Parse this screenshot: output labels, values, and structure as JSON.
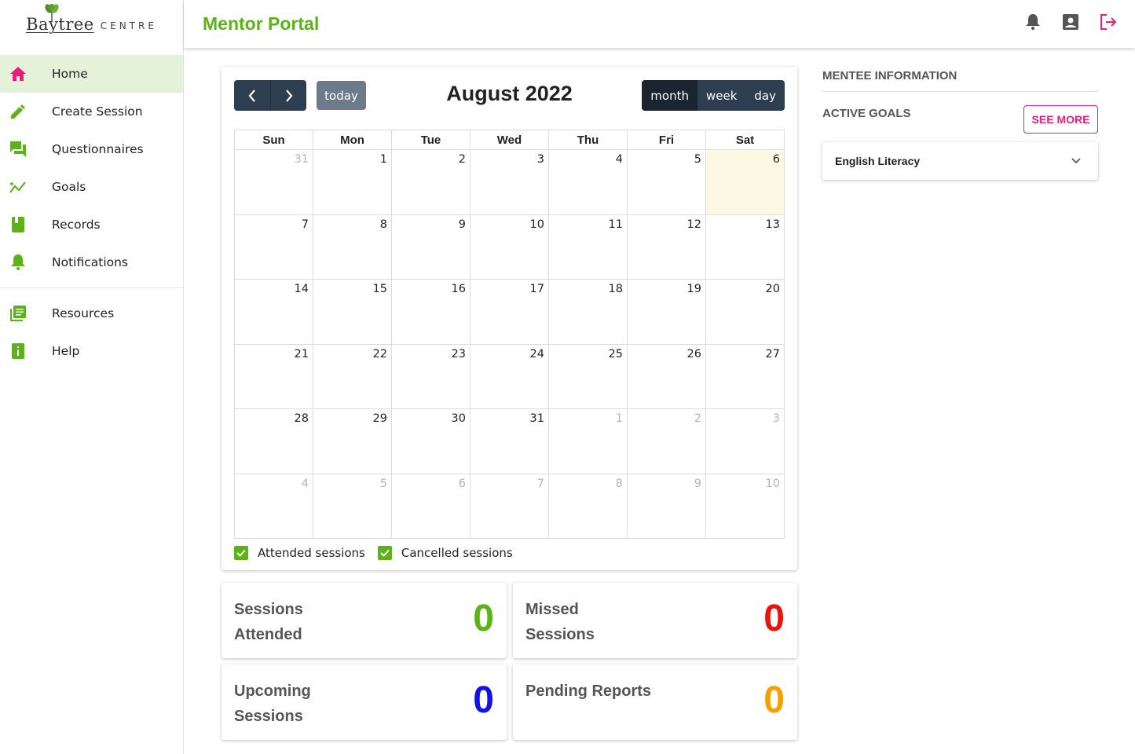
{
  "logo": {
    "main": "Baytree",
    "sub": "CENTRE"
  },
  "header": {
    "title": "Mentor Portal"
  },
  "sidebar": {
    "items": [
      {
        "label": "Home",
        "icon": "home-icon",
        "active": true
      },
      {
        "label": "Create Session",
        "icon": "pencil-icon"
      },
      {
        "label": "Questionnaires",
        "icon": "forum-icon"
      },
      {
        "label": "Goals",
        "icon": "sparkline-icon"
      },
      {
        "label": "Records",
        "icon": "book-icon"
      },
      {
        "label": "Notifications",
        "icon": "bell-icon"
      }
    ],
    "secondary": [
      {
        "label": "Resources",
        "icon": "list-document-icon"
      },
      {
        "label": "Help",
        "icon": "info-icon"
      }
    ]
  },
  "calendar": {
    "title": "August 2022",
    "today_label": "today",
    "views": [
      "month",
      "week",
      "day"
    ],
    "active_view": "month",
    "weekdays": [
      "Sun",
      "Mon",
      "Tue",
      "Wed",
      "Thu",
      "Fri",
      "Sat"
    ],
    "weeks": [
      [
        "31",
        "1",
        "2",
        "3",
        "4",
        "5",
        "6"
      ],
      [
        "7",
        "8",
        "9",
        "10",
        "11",
        "12",
        "13"
      ],
      [
        "14",
        "15",
        "16",
        "17",
        "18",
        "19",
        "20"
      ],
      [
        "21",
        "22",
        "23",
        "24",
        "25",
        "26",
        "27"
      ],
      [
        "28",
        "29",
        "30",
        "31",
        "1",
        "2",
        "3"
      ],
      [
        "4",
        "5",
        "6",
        "7",
        "8",
        "9",
        "10"
      ]
    ],
    "today_date": "6",
    "legend": [
      "Attended sessions",
      "Cancelled sessions"
    ]
  },
  "stats": [
    {
      "label": "Sessions Attended",
      "value": "0",
      "color": "#5bb318"
    },
    {
      "label": "Missed Sessions",
      "value": "0",
      "color": "#e8150c"
    },
    {
      "label": "Upcoming Sessions",
      "value": "0",
      "color": "#1212e6"
    },
    {
      "label": "Pending Reports",
      "value": "0",
      "color": "#f5a000"
    }
  ],
  "mentee": {
    "title": "MENTEE INFORMATION",
    "goals_title": "ACTIVE GOALS",
    "see_more": "SEE MORE",
    "goals": [
      "English Literacy"
    ]
  },
  "colors": {
    "accent_green": "#5bb318",
    "accent_pink": "#e91e7a",
    "nav_dark": "#2c3e50"
  }
}
